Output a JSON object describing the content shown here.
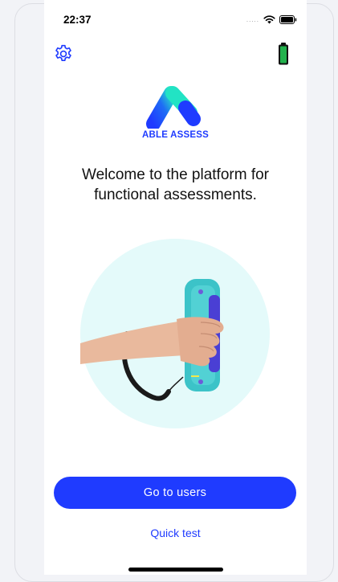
{
  "status_bar": {
    "time": "22:37",
    "signal_dots": "....."
  },
  "header": {
    "settings_icon": "gear-icon",
    "battery_icon": "device-battery-icon",
    "accent_color": "#1f3bff",
    "battery_color": "#22b14c"
  },
  "brand": {
    "name": "ABLE ASSESS"
  },
  "main": {
    "welcome_text": "Welcome to the platform for functional assessments.",
    "hero_image": "hand-holding-grip-device-illustration"
  },
  "actions": {
    "primary_label": "Go to users",
    "secondary_label": "Quick test"
  }
}
